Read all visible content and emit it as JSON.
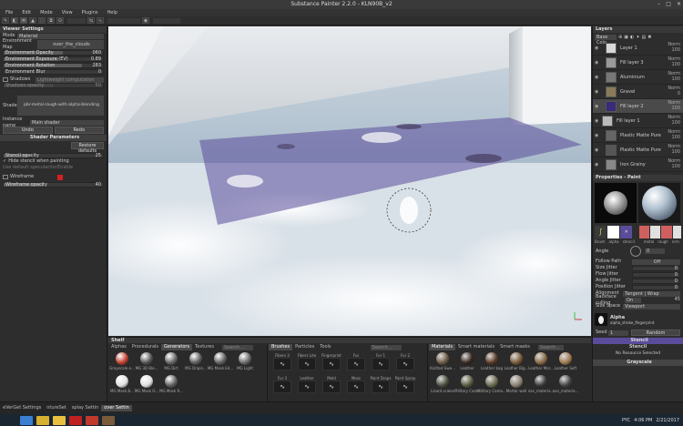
{
  "window": {
    "title": "Substance Painter 2.2.0 - KLN90B_v2",
    "controls": [
      "–",
      "□",
      "✕"
    ]
  },
  "menu": [
    "File",
    "Edit",
    "Mode",
    "View",
    "Plugins",
    "Help"
  ],
  "viewer_settings": {
    "title": "Viewer Settings",
    "mode_label": "Mode",
    "mode_value": "Material",
    "env_map_label": "Environment Map",
    "env_map_value": "over_the_clouds",
    "sliders": [
      {
        "label": "Environment Opacity",
        "value": "060",
        "fill": 0.6
      },
      {
        "label": "Environment Exposure (EV)",
        "value": "0.89",
        "fill": 0.55
      },
      {
        "label": "Environment Rotation",
        "value": "283",
        "fill": 0.79
      },
      {
        "label": "Environment Blur",
        "value": "0",
        "fill": 0.0
      }
    ],
    "shadows_label": "Shadows",
    "shadows_value": "Lightweight computation",
    "shadows_opacity_label": "Shadows opacity",
    "shadows_opacity_value": "50",
    "shader_label": "Shader",
    "shader_value": "pbr-metal-rough-with-alpha-blending",
    "instance_name_label": "Instance name",
    "instance_name_value": "Main shader",
    "undo": "Undo",
    "redo": "Redo",
    "shader_params_title": "Shader Parameters",
    "restore_defaults": "Restore defaults",
    "stencil_opacity_label": "Stencil opacity",
    "stencil_opacity_value": "25",
    "hide_stencil_label": "Hide stencil when painting",
    "default_label": "Use default specular/ior",
    "default_value": "Enable",
    "wireframe_label": "Wireframe",
    "wireframe_color": "#d42020",
    "wireframe_opacity_label": "Wireframe opacity",
    "wireframe_opacity_value": "40"
  },
  "layers": {
    "title": "Layers",
    "mode": "Base Colo",
    "items": [
      {
        "name": "Layer 1",
        "blend": "Norm",
        "opacity": "100",
        "thumb": "#d8d8d8",
        "indent": 1
      },
      {
        "name": "Fill layer 3",
        "blend": "Norm",
        "opacity": "100",
        "thumb": "#9a9a9a",
        "indent": 1
      },
      {
        "name": "Aluminium",
        "blend": "Norm",
        "opacity": "100",
        "thumb": "#777777",
        "indent": 1
      },
      {
        "name": "Gravel",
        "blend": "Norm",
        "opacity": "0",
        "thumb": "#8a7a5a",
        "indent": 1
      },
      {
        "name": "Fill layer 2",
        "blend": "Norm",
        "opacity": "100",
        "thumb": "#3a2a7a",
        "indent": 1,
        "selected": true
      },
      {
        "name": "Fill layer 1",
        "blend": "Norm",
        "opacity": "100",
        "thumb": "#bbbbbb",
        "indent": 0
      },
      {
        "name": "Plastic Matte Pure",
        "blend": "Norm",
        "opacity": "100",
        "thumb": "#666666",
        "indent": 1
      },
      {
        "name": "Plastic Matte Pure",
        "blend": "Norm",
        "opacity": "100",
        "thumb": "#555555",
        "indent": 1
      },
      {
        "name": "Iron Grainy",
        "blend": "Norm",
        "opacity": "100",
        "thumb": "#888888",
        "indent": 1
      }
    ]
  },
  "properties": {
    "title": "Properties - Paint",
    "brush_labels": [
      "Brush",
      "alpha",
      "stencil"
    ],
    "material_labels": [
      "metal",
      "rough",
      "nrm",
      "h"
    ],
    "angle_label": "Angle",
    "angle_value": "0",
    "follow_path_label": "Follow Path",
    "follow_path_value": "Off",
    "rows": [
      {
        "label": "Size Jitter",
        "value": "0"
      },
      {
        "label": "Flow Jitter",
        "value": "0"
      },
      {
        "label": "Angle Jitter",
        "value": "0"
      },
      {
        "label": "Position Jitter",
        "value": "0"
      }
    ],
    "alignment_label": "Alignment",
    "alignment_value": "Tangent | Wrap",
    "backface_label": "Backface culling",
    "backface_value": "On",
    "backface_num": "45",
    "size_space_label": "Size Space",
    "size_space_value": "Viewport",
    "alpha_title": "Alpha",
    "alpha_name": "alpha_stroke_fingerprint",
    "seed_label": "Seed",
    "seed_value": "1",
    "seed_random": "Random",
    "stencil_title": "Stencil",
    "stencil_sub": "Stencil",
    "stencil_none": "No Resource Selected",
    "grayscale_title": "Grayscale"
  },
  "shelf": {
    "title": "Shelf",
    "tabs_a": [
      "Alphas",
      "Procedurals",
      "Generators",
      "Textures"
    ],
    "tabs_a_active": "Generators",
    "search": "Search...",
    "gen_items": [
      {
        "label": "Grayscale e...",
        "color": "#c04030"
      },
      {
        "label": "MG 3D Ble...",
        "color": "#555555"
      },
      {
        "label": "MG Dirt",
        "color": "#666666"
      },
      {
        "label": "MG Dripin...",
        "color": "#5d5d5d"
      },
      {
        "label": "MG Mask Ed...",
        "color": "#616161"
      },
      {
        "label": "MG Light",
        "color": "#6a6a6a"
      },
      {
        "label": "MG Mask B...",
        "color": "#e0e0e0"
      },
      {
        "label": "MG Mask O...",
        "color": "#e0e0e0"
      },
      {
        "label": "MG Mask R...",
        "color": "#606060"
      }
    ],
    "tabs_b": [
      "Brushes",
      "Particles",
      "Tools"
    ],
    "tabs_b_active": "Brushes",
    "brush_items": [
      "Fibers 3",
      "Fibers Lite",
      "Fingerprint",
      "Fur",
      "Fur 1",
      "Fur 2",
      "Fur 3",
      "Leather",
      "Mold",
      "Moss",
      "Paint Drops",
      "Paint Spray"
    ],
    "tabs_c": [
      "Materials",
      "Smart materials",
      "Smart masks"
    ],
    "tabs_c_active": "Materials",
    "mat_items": [
      {
        "label": "Knitted Swe...",
        "color": "#6c5a45"
      },
      {
        "label": "Leather",
        "color": "#3a2a20"
      },
      {
        "label": "Leather bag",
        "color": "#5a3a25"
      },
      {
        "label": "Leather Big...",
        "color": "#7a5a3a"
      },
      {
        "label": "Leather Mor...",
        "color": "#8a6a45"
      },
      {
        "label": "Leather Soft",
        "color": "#a07a50"
      },
      {
        "label": "Lizard scales",
        "color": "#4a5040"
      },
      {
        "label": "Military Camo",
        "color": "#5a5a40"
      },
      {
        "label": "Military Camo...",
        "color": "#6a6a50"
      },
      {
        "label": "Mortar wall",
        "color": "#8a8070"
      },
      {
        "label": "nav_materia...",
        "color": "#3a3a3a"
      },
      {
        "label": "nav_materia...",
        "color": "#454545"
      }
    ]
  },
  "status_tabs": [
    "eVerGet Settings",
    "ntureSet",
    "splay Settin",
    "over Settin"
  ],
  "taskbar": {
    "time": "4:06 PM",
    "lang": "PYC",
    "date": "2/21/2017",
    "apps": [
      {
        "name": "start",
        "color": "#1b2633"
      },
      {
        "name": "ie",
        "color": "#3a7fd0"
      },
      {
        "name": "chrome",
        "color": "#d8b030"
      },
      {
        "name": "explorer",
        "color": "#e8c040"
      },
      {
        "name": "opera",
        "color": "#c02020"
      },
      {
        "name": "painter",
        "color": "#c0392b"
      },
      {
        "name": "designer",
        "color": "#7a5a3a"
      }
    ]
  },
  "colors": {
    "accent": "#5a4c9a",
    "panel": "#2d2d2d",
    "header": "#383838"
  }
}
